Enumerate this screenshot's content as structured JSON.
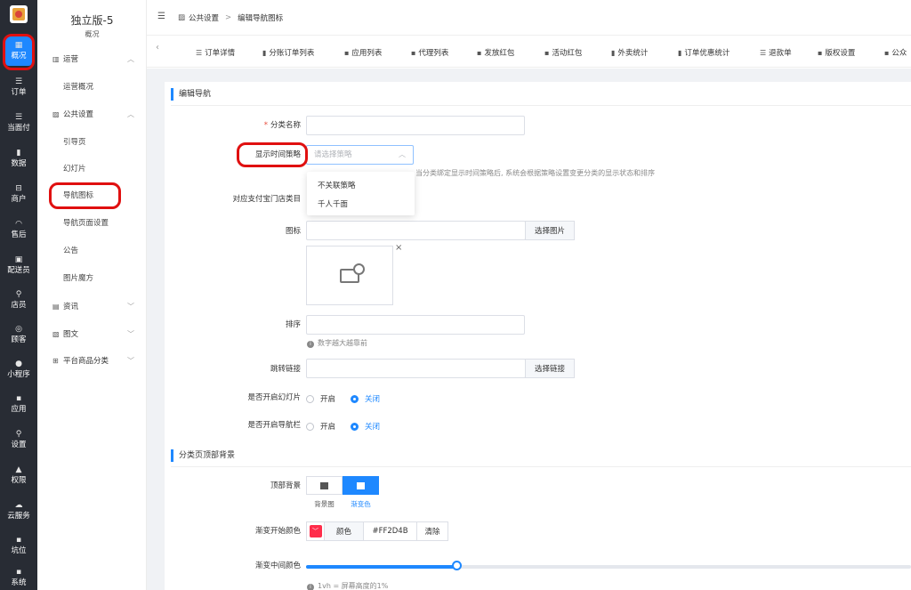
{
  "rail": {
    "items": [
      {
        "icon": "▦",
        "label": "概况"
      },
      {
        "icon": "☰",
        "label": "订单"
      },
      {
        "icon": "☰",
        "label": "当面付"
      },
      {
        "icon": "▮",
        "label": "数据"
      },
      {
        "icon": "⊟",
        "label": "商户"
      },
      {
        "icon": "◠",
        "label": "售后"
      },
      {
        "icon": "▣",
        "label": "配送员"
      },
      {
        "icon": "⚲",
        "label": "店员"
      },
      {
        "icon": "◎",
        "label": "顾客"
      },
      {
        "icon": "●",
        "label": "小程序"
      },
      {
        "icon": "▪",
        "label": "应用"
      },
      {
        "icon": "⚲",
        "label": "设置"
      },
      {
        "icon": "▲",
        "label": "权限"
      },
      {
        "icon": "☁",
        "label": "云服务"
      },
      {
        "icon": "▪",
        "label": "坑位"
      },
      {
        "icon": "▪",
        "label": "系统"
      }
    ]
  },
  "sidebar": {
    "store_name": "独立版-5",
    "store_sub": "概况",
    "group_ops": "运营",
    "ops_overview": "运营概况",
    "group_public": "公共设置",
    "guide_page": "引导页",
    "slides": "幻灯片",
    "nav_icon": "导航图标",
    "nav_page_settings": "导航页面设置",
    "notice": "公告",
    "image_magic": "图片魔方",
    "group_news": "资讯",
    "group_article": "图文",
    "group_category": "平台商品分类"
  },
  "header": {
    "breadcrumb_1": "公共设置",
    "breadcrumb_sep": ">",
    "breadcrumb_2": "编辑导航图标"
  },
  "tabs": [
    {
      "icon": "☰",
      "label": "订单详情"
    },
    {
      "icon": "▮",
      "label": "分账订单列表"
    },
    {
      "icon": "▪",
      "label": "应用列表"
    },
    {
      "icon": "▪",
      "label": "代理列表"
    },
    {
      "icon": "▪",
      "label": "发放红包"
    },
    {
      "icon": "▪",
      "label": "活动红包"
    },
    {
      "icon": "▮",
      "label": "外卖统计"
    },
    {
      "icon": "▮",
      "label": "订单优惠统计"
    },
    {
      "icon": "☰",
      "label": "退款单"
    },
    {
      "icon": "▪",
      "label": "版权设置"
    },
    {
      "icon": "▪",
      "label": "公众"
    }
  ],
  "form": {
    "section_edit": "编辑导航",
    "name_label": "分类名称",
    "name_required": "*",
    "strategy_label": "显示时间策略",
    "strategy_placeholder": "请选择策略",
    "strategy_hint": "当分类绑定显示时间策略后, 系统会根据策略设置变更分类的显示状态和排序",
    "strategy_options": [
      "不关联策略",
      "千人千面"
    ],
    "alipay_label": "对应支付宝门店类目",
    "icon_label": "图标",
    "choose_image": "选择图片",
    "close_mark": "×",
    "sort_label": "排序",
    "sort_hint": "数字越大越靠前",
    "link_label": "跳转链接",
    "choose_link": "选择链接",
    "slides_label": "是否开启幻灯片",
    "navbar_label": "是否开启导航栏",
    "on_label": "开启",
    "off_label": "关闭",
    "section_bg": "分类页顶部背景",
    "top_bg_label": "顶部背景",
    "bg_image": "背景图",
    "bg_gradient": "渐变色",
    "grad_start_label": "渐变开始颜色",
    "color_btn": "颜色",
    "grad_start_value": "#FF2D4B",
    "clear_btn": "清除",
    "grad_mid_label": "渐变中间颜色",
    "vh_hint": "1vh = 屏幕高度的1%",
    "accent": "#1e88ff",
    "swatch_color": "#FF2D4B"
  },
  "slider": {
    "value_fraction": 0.25
  }
}
